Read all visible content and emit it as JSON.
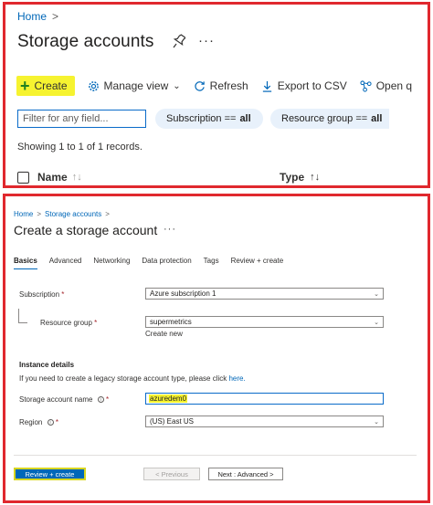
{
  "list_view": {
    "breadcrumb": {
      "home": "Home",
      "sep": ">"
    },
    "title": "Storage accounts",
    "more": "···",
    "toolbar": {
      "create": "Create",
      "manage_view": "Manage view",
      "refresh": "Refresh",
      "export_csv": "Export to CSV",
      "open_query": "Open q"
    },
    "filter": {
      "placeholder": "Filter for any field..."
    },
    "pills": {
      "subscription_label": "Subscription ==",
      "subscription_value": "all",
      "resource_group_label": "Resource group ==",
      "resource_group_value": "all"
    },
    "records": "Showing 1 to 1 of 1 records.",
    "columns": {
      "name": "Name",
      "type": "Type"
    },
    "sort_glyph": "↑↓"
  },
  "create_form": {
    "breadcrumb": {
      "home": "Home",
      "sep": ">",
      "storage_accounts": "Storage accounts"
    },
    "title": "Create a storage account",
    "more": "···",
    "tabs": [
      "Basics",
      "Advanced",
      "Networking",
      "Data protection",
      "Tags",
      "Review + create"
    ],
    "subscription": {
      "label": "Subscription",
      "value": "Azure subscription 1"
    },
    "resource_group": {
      "label": "Resource group",
      "value": "supermetrics",
      "create_new": "Create new"
    },
    "instance_details": {
      "heading": "Instance details",
      "legacy_text": "If you need to create a legacy storage account type, please click",
      "legacy_link": "here."
    },
    "storage_name": {
      "label": "Storage account name",
      "value": "azuredem0"
    },
    "region": {
      "label": "Region",
      "value": "(US) East US"
    },
    "required_mark": "*",
    "info_mark": "i",
    "buttons": {
      "review_create": "Review + create",
      "previous": "< Previous",
      "next": "Next : Advanced >"
    }
  },
  "colors": {
    "accent": "#0067b8",
    "highlight": "#f6f330",
    "frame": "#e0282e"
  }
}
